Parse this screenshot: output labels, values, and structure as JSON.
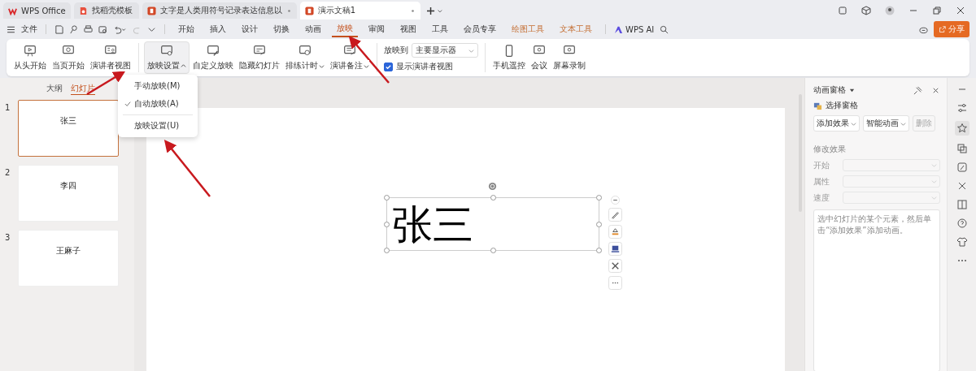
{
  "tabs": [
    {
      "label": "WPS Office",
      "kind": "home",
      "selected": false
    },
    {
      "label": "找稻壳模板",
      "kind": "template",
      "selected": false
    },
    {
      "label": "文字是人类用符号记录表达信息以",
      "kind": "doc",
      "selected": false
    },
    {
      "label": "演示文稿1",
      "kind": "doc",
      "selected": true
    }
  ],
  "menu": {
    "file": "文件",
    "items": [
      {
        "label": "开始",
        "kind": "tab",
        "selected": false
      },
      {
        "label": "插入",
        "kind": "tab",
        "selected": false
      },
      {
        "label": "设计",
        "kind": "tab",
        "selected": false
      },
      {
        "label": "切换",
        "kind": "tab",
        "selected": false
      },
      {
        "label": "动画",
        "kind": "tab",
        "selected": false
      },
      {
        "label": "放映",
        "kind": "tab",
        "selected": true
      },
      {
        "label": "审阅",
        "kind": "tab",
        "selected": false
      },
      {
        "label": "视图",
        "kind": "tab",
        "selected": false
      },
      {
        "label": "工具",
        "kind": "tab",
        "selected": false
      },
      {
        "label": "会员专享",
        "kind": "tab",
        "selected": false
      },
      {
        "label": "绘图工具",
        "kind": "contextual",
        "selected": false
      },
      {
        "label": "文本工具",
        "kind": "contextual",
        "selected": false
      }
    ],
    "ai": "WPS AI",
    "share": "分享"
  },
  "ribbon": {
    "groups": [
      [
        {
          "label": "从头开始",
          "caret": false,
          "selected": false
        },
        {
          "label": "当页开始",
          "caret": false,
          "selected": false
        },
        {
          "label": "演讲者视图",
          "caret": false,
          "selected": false
        }
      ],
      [
        {
          "label": "放映设置",
          "caret": true,
          "selected": true
        },
        {
          "label": "自定义放映",
          "caret": false,
          "selected": false
        },
        {
          "label": "隐藏幻灯片",
          "caret": false,
          "selected": false
        },
        {
          "label": "排练计时",
          "caret": true,
          "selected": false
        },
        {
          "label": "演讲备注",
          "caret": true,
          "selected": false
        }
      ]
    ],
    "output": {
      "label": "放映到",
      "value": "主要显示器"
    },
    "presenter_view": {
      "label": "显示演讲者视图",
      "checked": true
    },
    "tools": [
      {
        "label": "手机遥控"
      },
      {
        "label": "会议"
      },
      {
        "label": "屏幕录制"
      }
    ]
  },
  "dropdown": [
    {
      "label": "手动放映(M)",
      "checked": false,
      "kind": "option"
    },
    {
      "label": "自动放映(A)",
      "checked": true,
      "kind": "option"
    },
    {
      "label": "放映设置(U)",
      "checked": false,
      "kind": "command"
    }
  ],
  "left_panel": {
    "views": [
      {
        "label": "大纲",
        "selected": false
      },
      {
        "label": "幻灯片",
        "selected": true
      }
    ],
    "slides": [
      {
        "number": "1",
        "title": "张三",
        "selected": true
      },
      {
        "number": "2",
        "title": "李四",
        "selected": false
      },
      {
        "number": "3",
        "title": "王麻子",
        "selected": false
      }
    ]
  },
  "canvas": {
    "text": "张三"
  },
  "animation_pane": {
    "title": "动画窗格",
    "selection_pane": "选择窗格",
    "buttons": [
      {
        "label": "添加效果",
        "caret": true,
        "disabled": false
      },
      {
        "label": "智能动画",
        "caret": true,
        "disabled": false
      },
      {
        "label": "删除",
        "caret": false,
        "disabled": true
      }
    ],
    "section": "修改效果",
    "fields": [
      {
        "label": "开始"
      },
      {
        "label": "属性"
      },
      {
        "label": "速度"
      }
    ],
    "hint": "选中幻灯片的某个元素，然后单击“添加效果”添加动画。"
  }
}
